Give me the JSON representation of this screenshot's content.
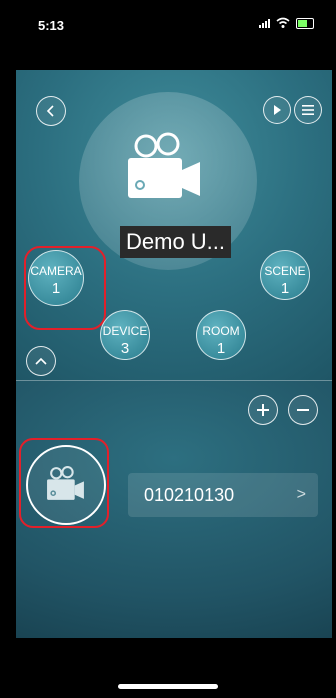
{
  "status": {
    "time": "5:13"
  },
  "header": {
    "title": "Demo U..."
  },
  "menu": {
    "camera": {
      "label": "CAMERA",
      "count": "1"
    },
    "scene": {
      "label": "SCENE",
      "count": "1"
    },
    "device": {
      "label": "DEVICE",
      "count": "3"
    },
    "room": {
      "label": "ROOM",
      "count": "1"
    }
  },
  "list": {
    "items": [
      {
        "label": "010210130"
      }
    ]
  },
  "colors": {
    "accent": "#2c6f80",
    "highlight": "#e3202a"
  }
}
